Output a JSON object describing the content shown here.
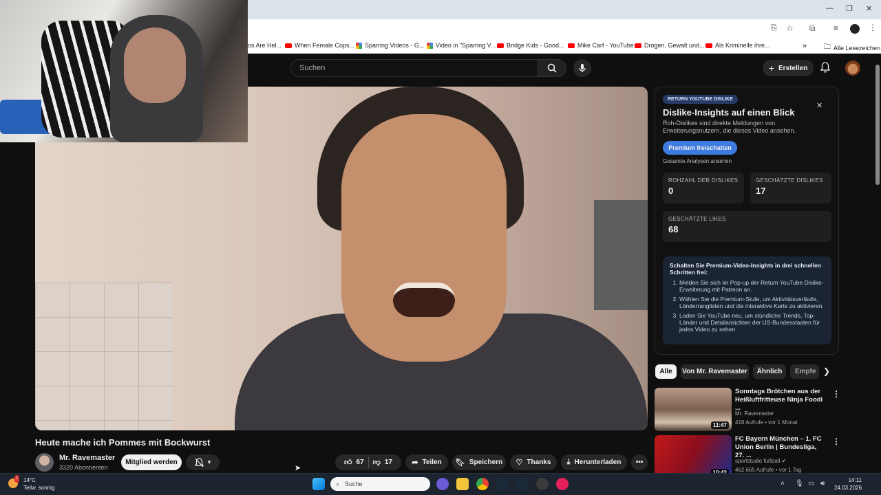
{
  "browser": {
    "bookmarks": [
      {
        "label": "os Are Hel...",
        "icon": "none"
      },
      {
        "label": "When Female Cops...",
        "icon": "youtube-icon"
      },
      {
        "label": "Sparring Videos - G...",
        "icon": "photos-icon"
      },
      {
        "label": "Video in \"Sparring V...",
        "icon": "photos-icon"
      },
      {
        "label": "Bridge Kids - Good...",
        "icon": "youtube-icon"
      },
      {
        "label": "Mike Carf - YouTube",
        "icon": "youtube-icon"
      },
      {
        "label": "Drogen, Gewalt und...",
        "icon": "youtube-icon"
      },
      {
        "label": "Als Kriminelle ihre...",
        "icon": "youtube-icon"
      }
    ],
    "bookmarks_overflow": "»",
    "all_bookmarks": "Alle Lesezeichen"
  },
  "header": {
    "search_placeholder": "Suchen",
    "create_label": "Erstellen"
  },
  "video": {
    "title": "Heute mache ich Pommes mit Bockwurst",
    "channel": "Mr. Ravemaster",
    "subscribers": "3320 Abonnenten",
    "member_label": "Mitglied werden",
    "likes": "67",
    "dislikes": "17",
    "share_label": "Teilen",
    "save_label": "Speichern",
    "thanks_label": "Thanks",
    "download_label": "Herunterladen"
  },
  "ryd": {
    "badge": "RETURN YOUTUBE DISLIKE",
    "title": "Dislike-Insights auf einen Blick",
    "subtitle": "Roh-Dislikes sind direkte Meldungen von Erweiterungsnutzern, die dieses Video ansehen.",
    "premium_label": "Premium freischalten",
    "all_analyses": "Gesamte Analysen ansehen",
    "stats": [
      {
        "label": "ROHZAHL DER DISLIKES",
        "value": "0"
      },
      {
        "label": "GESCHÄTZTE DISLIKES",
        "value": "17"
      },
      {
        "label": "GESCHÄTZTE LIKES",
        "value": "68"
      }
    ],
    "steps_heading": "Schalten Sie Premium-Video-Insights in drei schnellen Schritten frei:",
    "steps": [
      "Melden Sie sich im Pop-up der Return YouTube Dislike-Erweiterung mit Patreon an.",
      "Wählen Sie die Premium-Stufe, um Aktivitätsverläufe, Länderranglisten und die interaktive Karte zu aktivieren.",
      "Laden Sie YouTube neu, um stündliche Trends, Top-Länder und Detailansichten der US-Bundesstaaten für jedes Video zu sehen."
    ]
  },
  "chips": [
    "Alle",
    "Von Mr. Ravemaster",
    "Ähnlich",
    "Empfe"
  ],
  "recommendations": [
    {
      "title": "Sonntags Brötchen  aus der Heißluftfritteuse Ninja Foodi ...",
      "channel": "Mr. Ravemaster",
      "meta": "418 Aufrufe • vor 1 Monat",
      "duration": "11:47"
    },
    {
      "title": "FC Bayern München – 1. FC Union Berlin | Bundesliga, 27. ...",
      "channel": "sportstudio fußball",
      "meta": "462.665 Aufrufe • vor 1 Tag",
      "duration": "10:42"
    }
  ],
  "taskbar": {
    "temp": "14°C",
    "weather": "Teilw. sonnig",
    "weather_badge": "1",
    "search_label": "Suche",
    "time": "14:11",
    "date": "24.03.2026"
  }
}
